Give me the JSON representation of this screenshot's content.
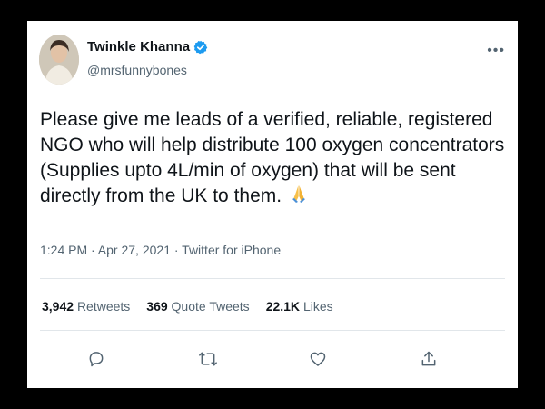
{
  "tweet": {
    "author": {
      "display_name": "Twinkle Khanna",
      "handle": "@mrsfunnybones",
      "verified": true
    },
    "text": "Please give me leads of a verified, reliable, registered NGO who will help distribute 100 oxygen concentrators (Supplies upto 4L/min of oxygen) that will be sent directly from the UK to them.",
    "emoji": "folded-hands-icon",
    "meta": "1:24 PM · Apr 27, 2021 · Twitter for iPhone",
    "stats": {
      "retweets_count": "3,942",
      "retweets_label": "Retweets",
      "quotes_count": "369",
      "quotes_label": "Quote Tweets",
      "likes_count": "22.1K",
      "likes_label": "Likes"
    },
    "actions": [
      "reply-icon",
      "retweet-icon",
      "like-icon",
      "share-icon"
    ]
  },
  "colors": {
    "frame": "#000000",
    "card": "#ffffff",
    "text": "#0f1419",
    "secondary": "#536471",
    "verified": "#1d9bf0",
    "divider": "#e1e6ea"
  }
}
